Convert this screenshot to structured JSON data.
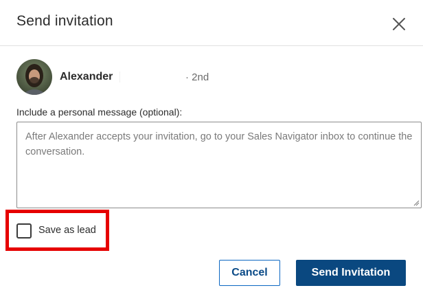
{
  "dialog": {
    "title": "Send invitation",
    "close_icon": "close-icon"
  },
  "recipient": {
    "name": "Alexander",
    "degree": "· 2nd",
    "avatar_icon": "avatar"
  },
  "message": {
    "label": "Include a personal message (optional):",
    "placeholder": "After Alexander accepts your invitation, go to your Sales Navigator inbox to continue the conversation.",
    "value": ""
  },
  "save_as_lead": {
    "label": "Save as lead",
    "checked": false,
    "highlight_color": "#e60000"
  },
  "actions": {
    "cancel_label": "Cancel",
    "send_label": "Send Invitation",
    "primary_color": "#0a4880"
  }
}
